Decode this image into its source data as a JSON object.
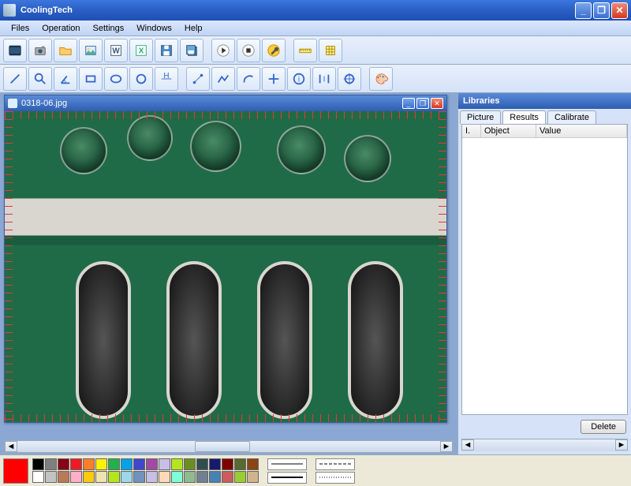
{
  "app": {
    "title": "CoolingTech"
  },
  "menu": {
    "files": "Files",
    "operation": "Operation",
    "settings": "Settings",
    "windows": "Windows",
    "help": "Help"
  },
  "image_window": {
    "title": "0318-06.jpg"
  },
  "libraries": {
    "title": "Libraries",
    "tabs": {
      "picture": "Picture",
      "results": "Results",
      "calibrate": "Calibrate"
    },
    "columns": {
      "idx": "I.",
      "object": "Object",
      "value": "Value"
    },
    "delete": "Delete"
  },
  "palette": {
    "current": "#ff0000",
    "row1": [
      "#000000",
      "#7f7f7f",
      "#880015",
      "#ed1c24",
      "#ff7f27",
      "#fff200",
      "#22b14c",
      "#00a2e8",
      "#3f48cc",
      "#a349a4",
      "#c8bfe7",
      "#b5e61d",
      "#6b8e23",
      "#2f4f4f",
      "#191970",
      "#800000",
      "#556b2f",
      "#8b4513"
    ],
    "row2": [
      "#ffffff",
      "#c3c3c3",
      "#b97a57",
      "#ffaec9",
      "#ffc90e",
      "#efe4b0",
      "#b5e61d",
      "#99d9ea",
      "#7092be",
      "#c8bfe7",
      "#ffdab9",
      "#7fffd4",
      "#8fbc8f",
      "#708090",
      "#4682b4",
      "#cd5c5c",
      "#9acd32",
      "#d2b48c"
    ]
  }
}
